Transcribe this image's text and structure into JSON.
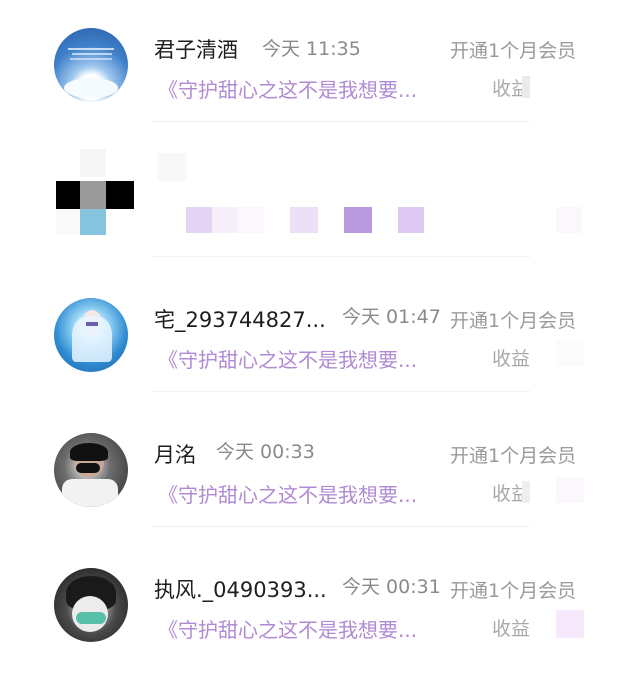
{
  "items": [
    {
      "name": "君子清酒",
      "time": "今天 11:35",
      "action": "开通1个月会员",
      "message": "《守护甜心之这不是我想要...",
      "income_label": "收益"
    },
    {
      "name": "",
      "time": "",
      "action": "",
      "message": "",
      "income_label": ""
    },
    {
      "name": "宅_293744827...",
      "time": "今天 01:47",
      "action": "开通1个月会员",
      "message": "《守护甜心之这不是我想要...",
      "income_label": "收益"
    },
    {
      "name": "月洺",
      "time": "今天 00:33",
      "action": "开通1个月会员",
      "message": "《守护甜心之这不是我想要...",
      "income_label": "收益"
    },
    {
      "name": "执风._0490393...",
      "time": "今天 00:31",
      "action": "开通1个月会员",
      "message": "《守护甜心之这不是我想要...",
      "income_label": "收益"
    }
  ],
  "colors": {
    "message_purple": "#b08bd3",
    "muted_gray": "#9a9a9a"
  }
}
